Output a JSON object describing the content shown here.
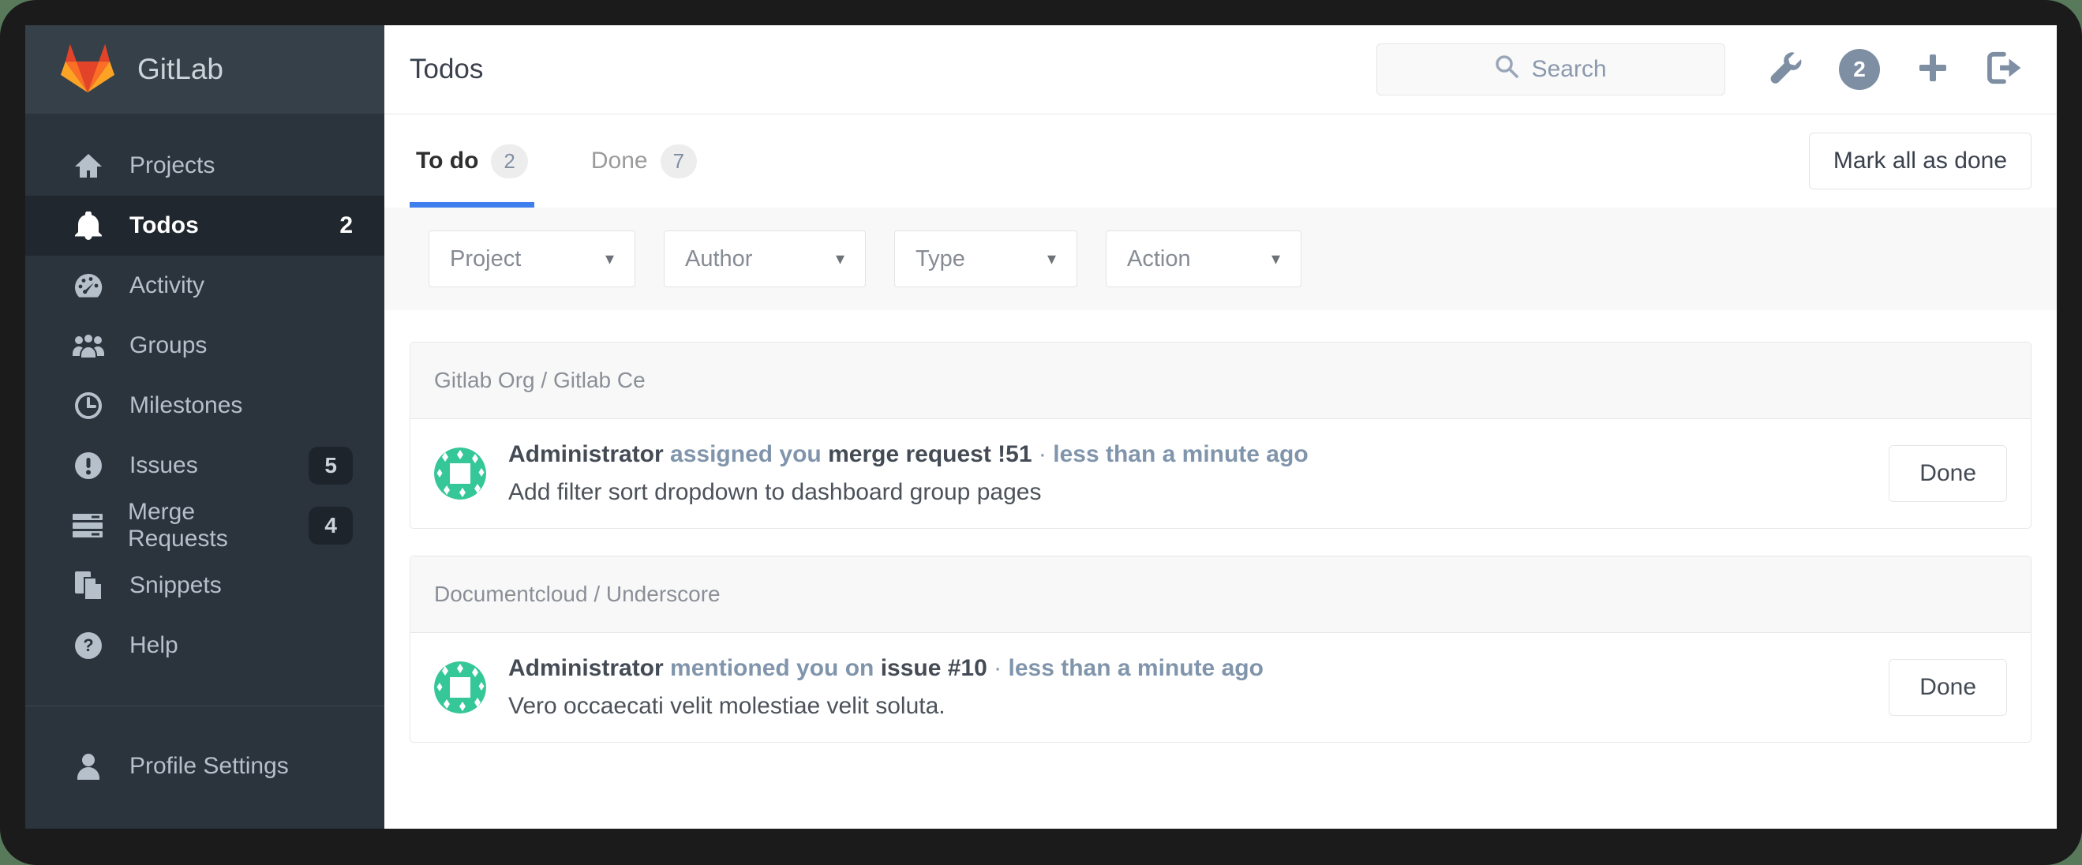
{
  "sidebar": {
    "logo_text": "GitLab",
    "items": [
      {
        "label": "Projects"
      },
      {
        "label": "Todos",
        "count": "2"
      },
      {
        "label": "Activity"
      },
      {
        "label": "Groups"
      },
      {
        "label": "Milestones"
      },
      {
        "label": "Issues",
        "badge": "5"
      },
      {
        "label": "Merge Requests",
        "badge": "4"
      },
      {
        "label": "Snippets"
      },
      {
        "label": "Help"
      }
    ],
    "footer_item": {
      "label": "Profile Settings"
    }
  },
  "header": {
    "title": "Todos",
    "search_placeholder": "Search",
    "todo_count_badge": "2"
  },
  "tabs": [
    {
      "label": "To do",
      "count": "2"
    },
    {
      "label": "Done",
      "count": "7"
    }
  ],
  "mark_all_label": "Mark all as done",
  "filters": [
    {
      "label": "Project",
      "caret": "▾"
    },
    {
      "label": "Author",
      "caret": "▾"
    },
    {
      "label": "Type",
      "caret": "▾"
    },
    {
      "label": "Action",
      "caret": "▾"
    }
  ],
  "groups": [
    {
      "project": "Gitlab Org / Gitlab Ce",
      "todo": {
        "author": "Administrator",
        "action": "assigned you",
        "target": "merge request !51",
        "separator": "·",
        "time": "less than a minute ago",
        "body": "Add filter sort dropdown to dashboard group pages",
        "button": "Done"
      }
    },
    {
      "project": "Documentcloud / Underscore",
      "todo": {
        "author": "Administrator",
        "action": "mentioned you on",
        "target": "issue #10",
        "separator": "·",
        "time": "less than a minute ago",
        "body": "Vero occaecati velit molestiae velit soluta.",
        "button": "Done"
      }
    }
  ],
  "colors": {
    "accent_blue": "#3e7fed",
    "avatar_teal": "#35c797",
    "logo_red": "#e24329",
    "logo_orange": "#fc6d26",
    "logo_yellow": "#fca326",
    "sidebar_bg": "#2b333d",
    "icon_slate": "#7e8fa4"
  }
}
